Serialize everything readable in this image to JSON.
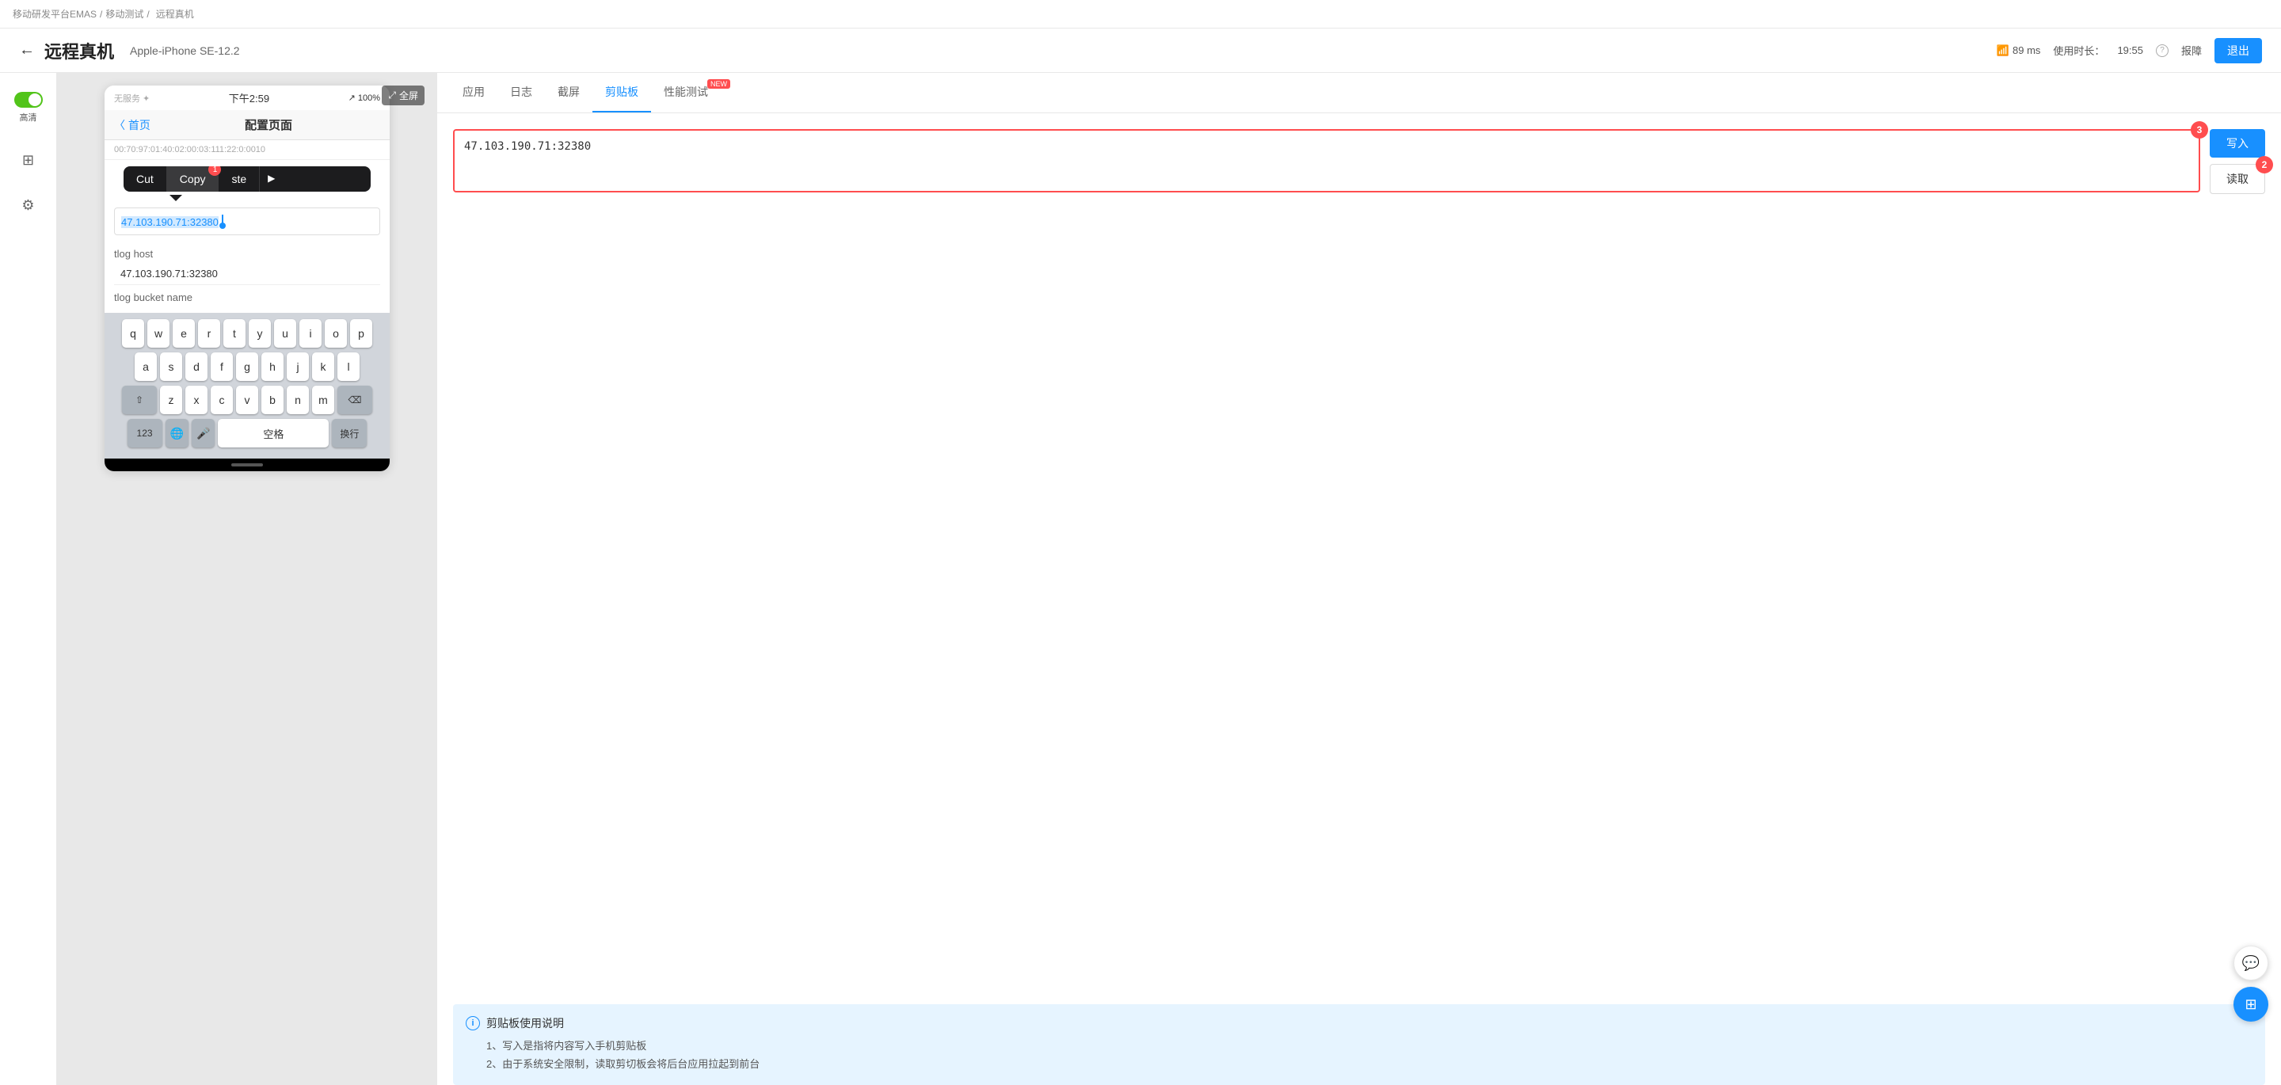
{
  "breadcrumb": {
    "items": [
      "移动研发平台EMAS",
      "移动测试",
      "远程真机"
    ],
    "separators": [
      "/",
      "/"
    ]
  },
  "header": {
    "back_label": "←",
    "title": "远程真机",
    "device_name": "Apple-iPhone SE-12.2",
    "signal": "89 ms",
    "usage_label": "使用时长：",
    "usage_time": "19:55",
    "report_label": "报障",
    "exit_label": "退出"
  },
  "sidebar": {
    "hd_label": "高清",
    "split_label": "",
    "settings_label": ""
  },
  "phone": {
    "status_bar": {
      "left": "无服务 ✦",
      "center": "下午2:59",
      "right": "↗ 100%"
    },
    "nav": {
      "back": "〈 首页",
      "title": "配置页面"
    },
    "context_menu": {
      "cut": "Cut",
      "copy": "Copy",
      "paste": "ste",
      "arrow": "▶",
      "badge": "1"
    },
    "selected_text": "47.103.190.71:32380",
    "fields": [
      {
        "label": "tlog host",
        "value": "47.103.190.71:32380"
      },
      {
        "label": "tlog bucket name",
        "value": ""
      }
    ],
    "keyboard": {
      "row1": [
        "q",
        "w",
        "e",
        "r",
        "t",
        "y",
        "u",
        "i",
        "o",
        "p"
      ],
      "row2": [
        "a",
        "s",
        "d",
        "f",
        "g",
        "h",
        "j",
        "k",
        "l"
      ],
      "row3_prefix": "⇧",
      "row3": [
        "z",
        "x",
        "c",
        "v",
        "b",
        "n",
        "m"
      ],
      "row3_suffix": "⌫",
      "row4": [
        "123",
        "🌐",
        "🎤",
        "空格",
        "换行"
      ]
    },
    "fullscreen_label": "全屏"
  },
  "tabs": [
    {
      "id": "app",
      "label": "应用",
      "active": false,
      "badge": null
    },
    {
      "id": "log",
      "label": "日志",
      "active": false,
      "badge": null
    },
    {
      "id": "screenshot",
      "label": "截屏",
      "active": false,
      "badge": null
    },
    {
      "id": "clipboard",
      "label": "剪贴板",
      "active": true,
      "badge": null
    },
    {
      "id": "perf",
      "label": "性能测试",
      "active": false,
      "badge": "NEW"
    }
  ],
  "clipboard": {
    "textarea_value": "47.103.190.71:32380",
    "write_btn": "写入",
    "read_btn": "读取",
    "step3_badge": "3",
    "step2_badge": "2",
    "info": {
      "title": "剪贴板使用说明",
      "items": [
        "1、写入是指将内容写入手机剪贴板",
        "2、由于系统安全限制，读取剪切板会将后台应用拉起到前台"
      ]
    }
  }
}
